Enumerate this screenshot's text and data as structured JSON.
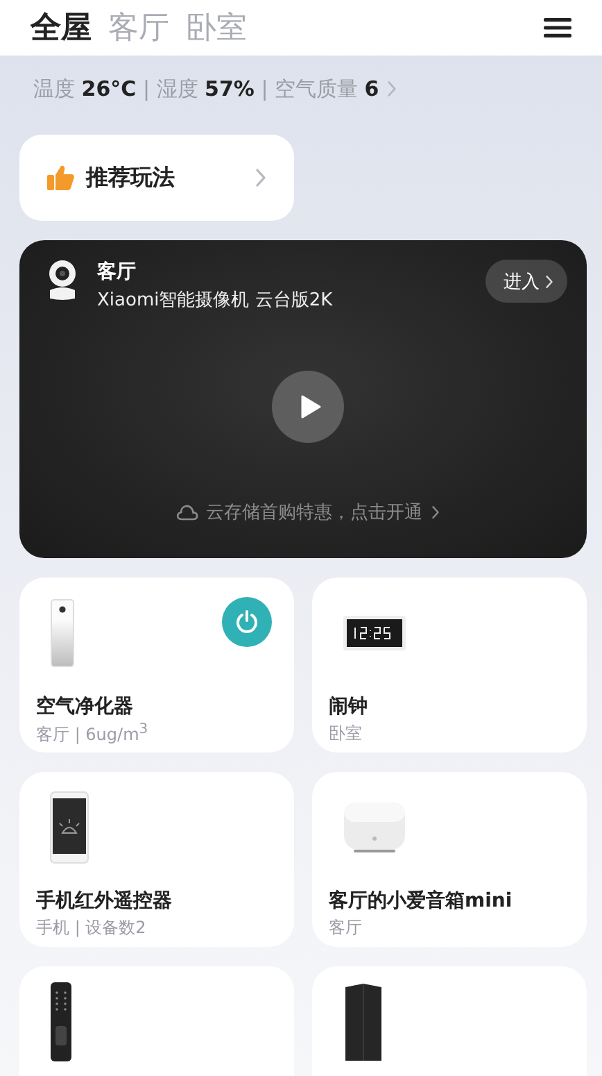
{
  "tabs": [
    {
      "label": "全屋",
      "selected": true
    },
    {
      "label": "客厅",
      "selected": false
    },
    {
      "label": "卧室",
      "selected": false
    }
  ],
  "environment": {
    "text": "温度 **26°C** | 湿度 **57%** | 空气质量 **6**"
  },
  "recommend": {
    "label": "推荐玩法"
  },
  "camera": {
    "room": "客厅",
    "model": "Xiaomi智能摄像机 云台版2K",
    "enter": "进入",
    "promo": "云存储首购特惠，点击开通"
  },
  "devices": [
    {
      "kind": "purifier",
      "name": "空气净化器",
      "detail": "客厅 | 6ug/m$^{3}$",
      "power": {
        "on": true
      }
    },
    {
      "kind": "clock",
      "name": "闹钟",
      "detail": "卧室"
    },
    {
      "kind": "phone",
      "name": "手机红外遥控器",
      "detail": "手机 | 设备数2"
    },
    {
      "kind": "speaker",
      "name": "客厅的小爱音箱mini",
      "detail": "客厅"
    },
    {
      "kind": "lock"
    },
    {
      "kind": "router"
    }
  ]
}
